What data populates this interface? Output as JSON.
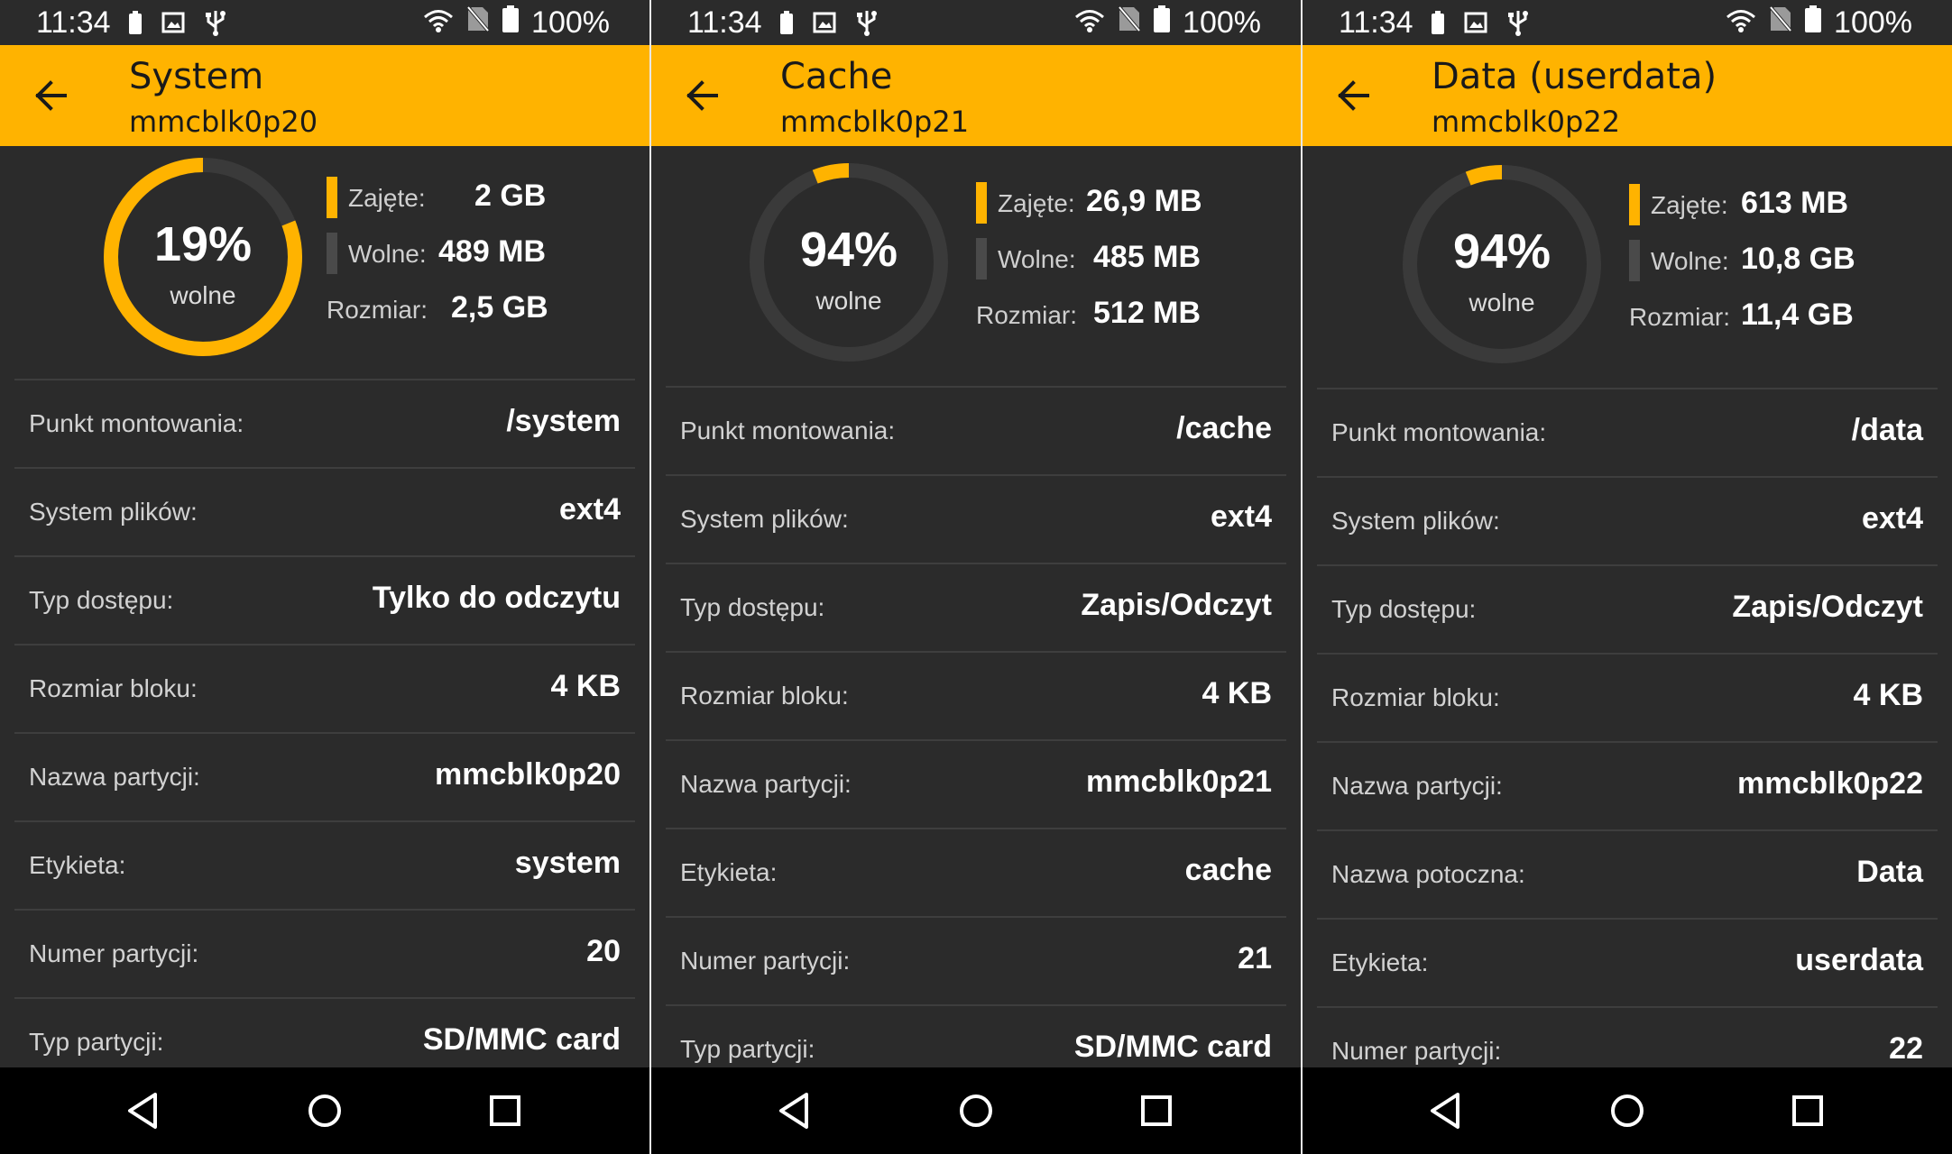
{
  "colors": {
    "accent": "#ffb300",
    "free_track": "#3a3a3a",
    "used": "#ffb300",
    "free": "#4a4a4a"
  },
  "screens": [
    {
      "status": {
        "time": "11:34",
        "battery": "100%"
      },
      "title": "System",
      "subtitle": "mmcblk0p20",
      "donut": {
        "percent_label": "19%",
        "label": "wolne",
        "used_fraction": 0.81
      },
      "legend": {
        "used_label": "Zajęte:",
        "used_value": "2 GB",
        "free_label": "Wolne:",
        "free_value": "489 MB",
        "size_label": "Rozmiar:",
        "size_value": "2,5 GB"
      },
      "rows": [
        {
          "label": "Punkt montowania:",
          "value": "/system"
        },
        {
          "label": "System plików:",
          "value": "ext4"
        },
        {
          "label": "Typ dostępu:",
          "value": "Tylko do odczytu"
        },
        {
          "label": "Rozmiar bloku:",
          "value": "4 KB"
        },
        {
          "label": "Nazwa partycji:",
          "value": "mmcblk0p20"
        },
        {
          "label": "Etykieta:",
          "value": "system"
        },
        {
          "label": "Numer partycji:",
          "value": "20"
        },
        {
          "label": "Typ partycji:",
          "value": "SD/MMC card"
        }
      ]
    },
    {
      "status": {
        "time": "11:34",
        "battery": "100%"
      },
      "title": "Cache",
      "subtitle": "mmcblk0p21",
      "donut": {
        "percent_label": "94%",
        "label": "wolne",
        "used_fraction": 0.06
      },
      "legend": {
        "used_label": "Zajęte:",
        "used_value": "26,9 MB",
        "free_label": "Wolne:",
        "free_value": "485 MB",
        "size_label": "Rozmiar:",
        "size_value": "512 MB"
      },
      "rows": [
        {
          "label": "Punkt montowania:",
          "value": "/cache"
        },
        {
          "label": "System plików:",
          "value": "ext4"
        },
        {
          "label": "Typ dostępu:",
          "value": "Zapis/Odczyt"
        },
        {
          "label": "Rozmiar bloku:",
          "value": "4 KB"
        },
        {
          "label": "Nazwa partycji:",
          "value": "mmcblk0p21"
        },
        {
          "label": "Etykieta:",
          "value": "cache"
        },
        {
          "label": "Numer partycji:",
          "value": "21"
        },
        {
          "label": "Typ partycji:",
          "value": "SD/MMC card"
        }
      ]
    },
    {
      "status": {
        "time": "11:34",
        "battery": "100%"
      },
      "title": "Data (userdata)",
      "subtitle": "mmcblk0p22",
      "donut": {
        "percent_label": "94%",
        "label": "wolne",
        "used_fraction": 0.06
      },
      "legend": {
        "used_label": "Zajęte:",
        "used_value": "613 MB",
        "free_label": "Wolne:",
        "free_value": "10,8 GB",
        "size_label": "Rozmiar:",
        "size_value": "11,4 GB"
      },
      "rows": [
        {
          "label": "Punkt montowania:",
          "value": "/data"
        },
        {
          "label": "System plików:",
          "value": "ext4"
        },
        {
          "label": "Typ dostępu:",
          "value": "Zapis/Odczyt"
        },
        {
          "label": "Rozmiar bloku:",
          "value": "4 KB"
        },
        {
          "label": "Nazwa partycji:",
          "value": "mmcblk0p22"
        },
        {
          "label": "Nazwa potoczna:",
          "value": "Data"
        },
        {
          "label": "Etykieta:",
          "value": "userdata"
        },
        {
          "label": "Numer partycji:",
          "value": "22"
        }
      ]
    }
  ],
  "icons": [
    "battery-icon",
    "image-icon",
    "usb-icon",
    "wifi-icon",
    "no-sim-icon",
    "back-arrow-icon",
    "nav-back-icon",
    "nav-home-icon",
    "nav-recents-icon"
  ]
}
